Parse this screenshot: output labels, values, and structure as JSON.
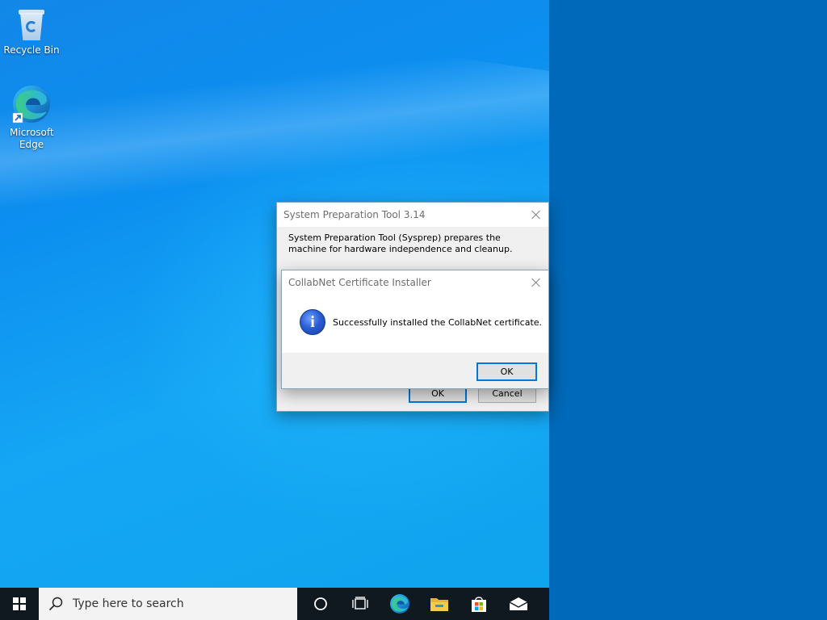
{
  "desktop": {
    "icons": [
      {
        "label": "Recycle Bin",
        "icon": "recycle-bin-icon"
      },
      {
        "label": "Microsoft Edge",
        "icon": "edge-icon"
      }
    ]
  },
  "sysprep_window": {
    "title": "System Preparation Tool 3.14",
    "description": "System Preparation Tool (Sysprep) prepares the machine for hardware independence and cleanup.",
    "ok_label": "OK",
    "cancel_label": "Cancel"
  },
  "message_box": {
    "title": "CollabNet Certificate Installer",
    "message": "Successfully installed the CollabNet certificate.",
    "icon": "info-icon",
    "ok_label": "OK"
  },
  "taskbar": {
    "search_placeholder": "Type here to search",
    "pinned": [
      "cortana-icon",
      "task-view-icon",
      "edge-icon",
      "file-explorer-icon",
      "store-icon",
      "mail-icon"
    ]
  },
  "colors": {
    "accent": "#0078d7",
    "taskbar": "#101820"
  }
}
